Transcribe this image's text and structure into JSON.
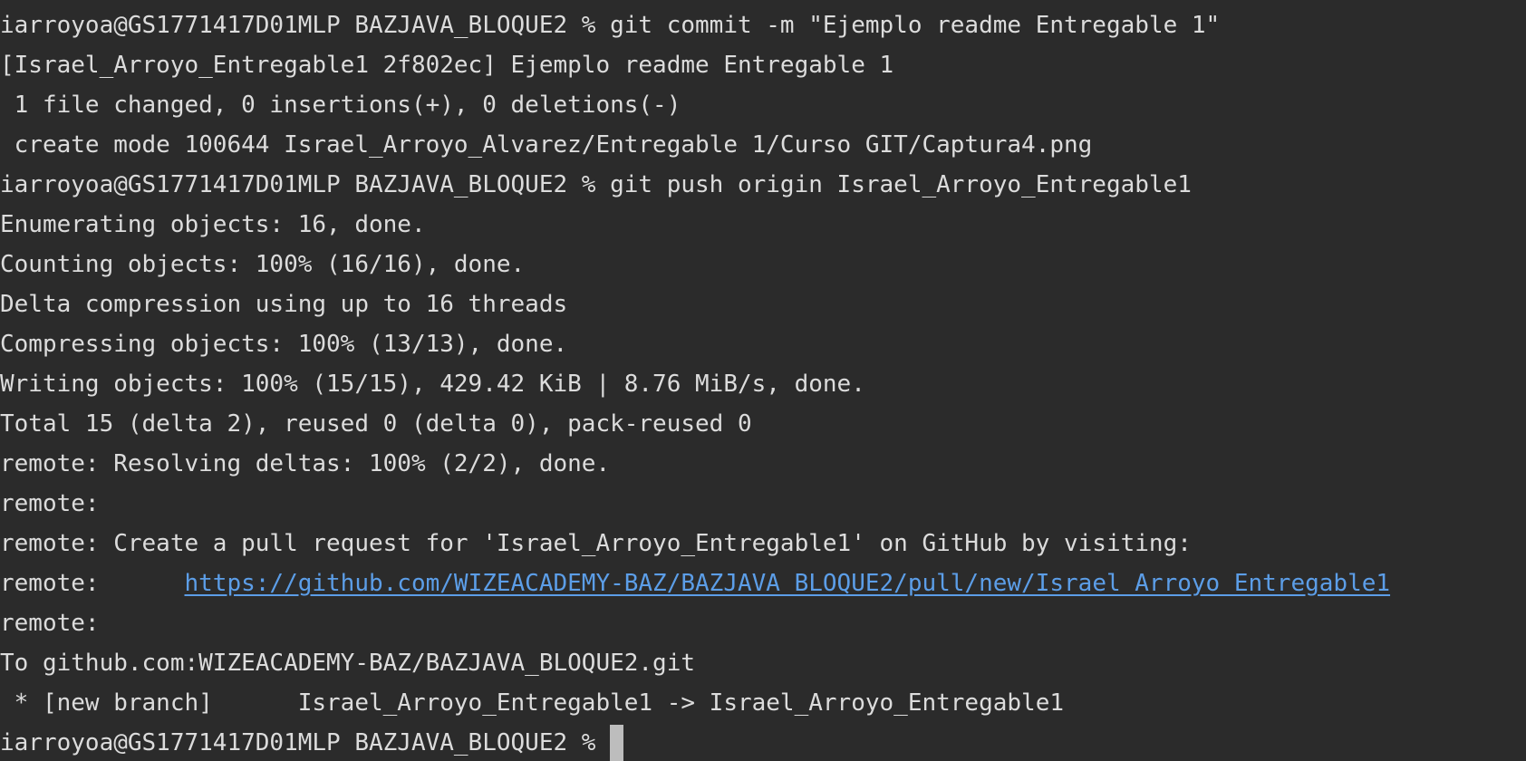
{
  "terminal": {
    "lines": [
      "iarroyoa@GS1771417D01MLP BAZJAVA_BLOQUE2 % git commit -m \"Ejemplo readme Entregable 1\"",
      "[Israel_Arroyo_Entregable1 2f802ec] Ejemplo readme Entregable 1",
      " 1 file changed, 0 insertions(+), 0 deletions(-)",
      " create mode 100644 Israel_Arroyo_Alvarez/Entregable 1/Curso GIT/Captura4.png",
      "iarroyoa@GS1771417D01MLP BAZJAVA_BLOQUE2 % git push origin Israel_Arroyo_Entregable1",
      "Enumerating objects: 16, done.",
      "Counting objects: 100% (16/16), done.",
      "Delta compression using up to 16 threads",
      "Compressing objects: 100% (13/13), done.",
      "Writing objects: 100% (15/15), 429.42 KiB | 8.76 MiB/s, done.",
      "Total 15 (delta 2), reused 0 (delta 0), pack-reused 0",
      "remote: Resolving deltas: 100% (2/2), done.",
      "remote:",
      "remote: Create a pull request for 'Israel_Arroyo_Entregable1' on GitHub by visiting:"
    ],
    "link_line": {
      "prefix": "remote:      ",
      "url": "https://github.com/WIZEACADEMY-BAZ/BAZJAVA_BLOQUE2/pull/new/Israel_Arroyo_Entregable1"
    },
    "lines_after": [
      "remote:",
      "To github.com:WIZEACADEMY-BAZ/BAZJAVA_BLOQUE2.git",
      " * [new branch]      Israel_Arroyo_Entregable1 -> Israel_Arroyo_Entregable1"
    ],
    "prompt": "iarroyoa@GS1771417D01MLP BAZJAVA_BLOQUE2 %"
  },
  "colors": {
    "background": "#2b2b2b",
    "text": "#dcdcdc",
    "link": "#5c9ee8",
    "cursor": "#bdbdbd"
  }
}
